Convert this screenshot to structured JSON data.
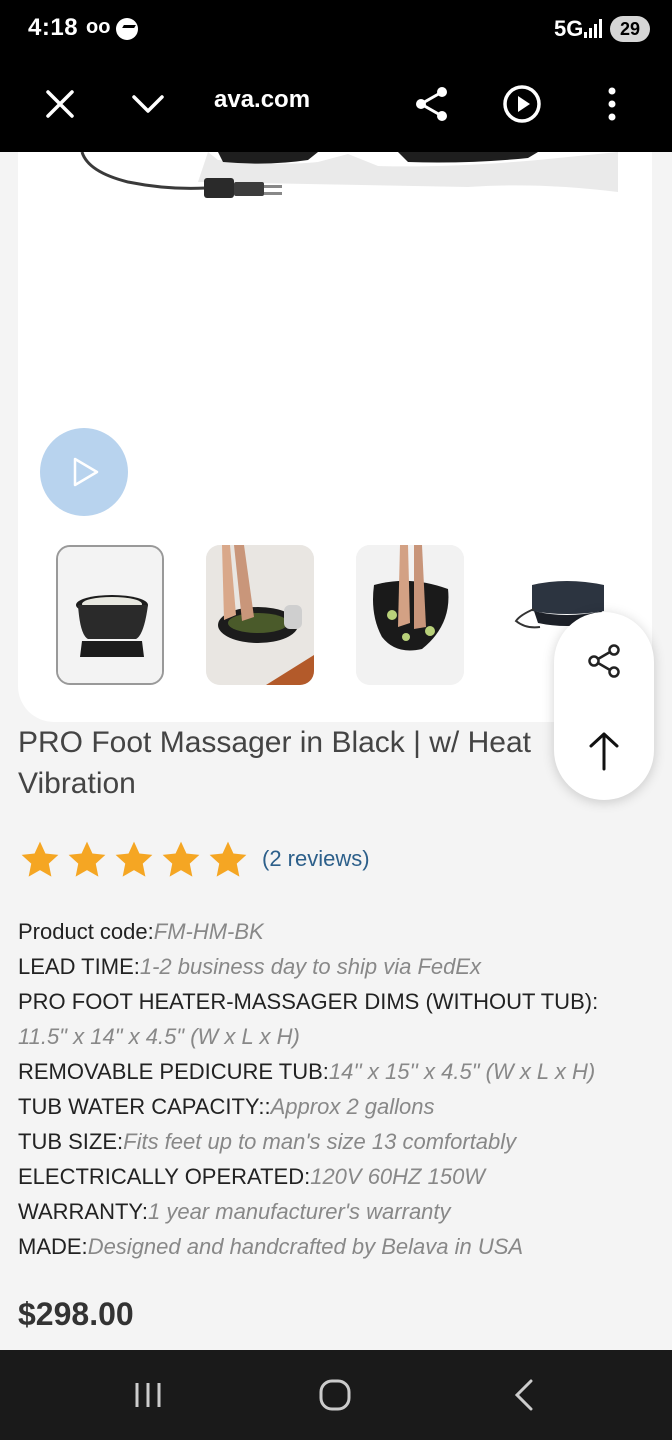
{
  "status_bar": {
    "time": "4:18",
    "voicemail": "oo",
    "network": "5G",
    "battery": "29"
  },
  "browser": {
    "url": "ava.com",
    "icons": [
      "close-icon",
      "chevron-down-icon",
      "share-icon",
      "play-circle-icon",
      "more-vert-icon"
    ]
  },
  "product": {
    "title": "PRO Foot Massager in Black | w/ Heat Vibration",
    "rating_stars": 5,
    "rating_max": 5,
    "reviews_text": "(2 reviews)",
    "price": "$298.00"
  },
  "specs": [
    {
      "label": "Product code:",
      "value": "FM-HM-BK"
    },
    {
      "label": "LEAD TIME:",
      "value": "1-2 business day to ship via FedEx"
    },
    {
      "label": "PRO FOOT HEATER-MASSAGER DIMS (WITHOUT TUB):",
      "value": ""
    },
    {
      "label": "",
      "value": "11.5\" x 14\" x 4.5\" (W x L x H)"
    },
    {
      "label": "REMOVABLE PEDICURE TUB:",
      "value": "14'' x 15'' x 4.5\" (W x L x H)"
    },
    {
      "label": "TUB WATER CAPACITY::",
      "value": "Approx 2 gallons"
    },
    {
      "label": "TUB SIZE:",
      "value": "Fits feet up to man's size 13 comfortably"
    },
    {
      "label": "ELECTRICALLY OPERATED:",
      "value": "120V 60HZ 150W"
    },
    {
      "label": "WARRANTY:",
      "value": "1 year manufacturer's warranty"
    },
    {
      "label": "MADE:",
      "value": "Designed and handcrafted by Belava in USA"
    }
  ],
  "colors": {
    "star": "#f5a623",
    "link": "#2c5f8a",
    "video_button": "#b8d3ee"
  }
}
